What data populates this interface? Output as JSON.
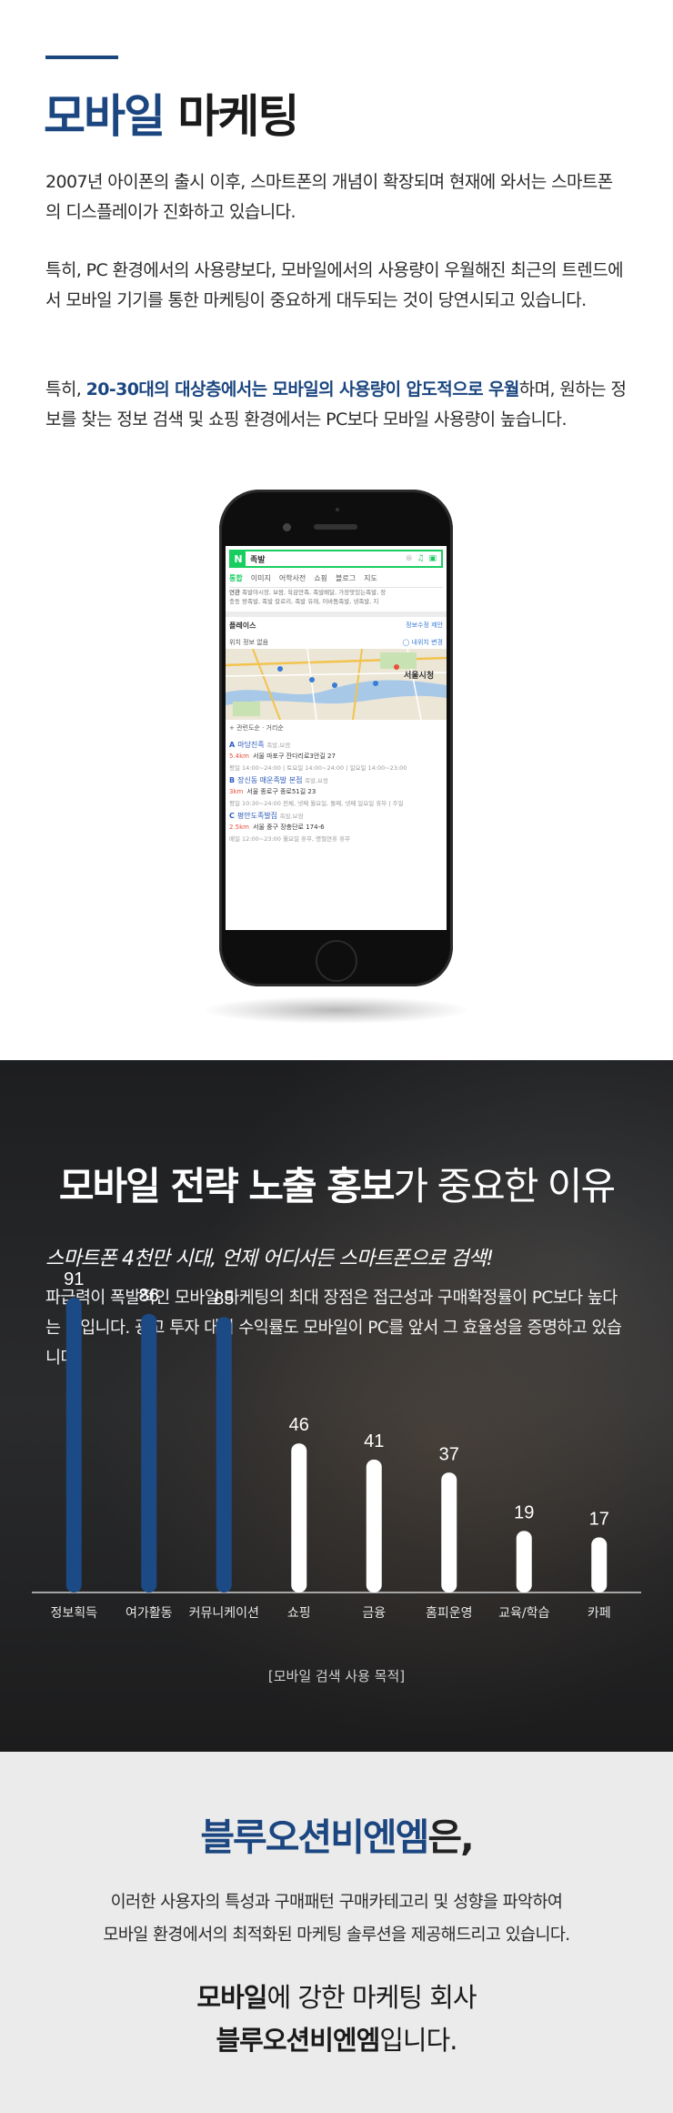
{
  "intro": {
    "title_highlight": "모바일",
    "title_rest": " 마케팅",
    "para1": "2007년 아이폰의 출시 이후, 스마트폰의 개념이 확장되며 현재에 와서는 스마트폰의 디스플레이가 진화하고 있습니다.",
    "para2": "특히, PC 환경에서의 사용량보다, 모바일에서의 사용량이 우월해진 최근의 트렌드에서 모바일 기기를 통한 마케팅이 중요하게 대두되는 것이 당연시되고 있습니다.",
    "para3_prefix": "특히, ",
    "para3_highlight": "20-30대의 대상층에서는 모바일의 사용량이 압도적으로 우월",
    "para3_suffix": "하며, 원하는 정보를 찾는 정보 검색 및 쇼핑 환경에서는 PC보다 모바일 사용량이 높습니다."
  },
  "phone_screen": {
    "logo": "N",
    "query": "족발",
    "tabs": [
      "통합",
      "이미지",
      "어학사전",
      "쇼핑",
      "블로그",
      "지도"
    ],
    "related_label": "연관",
    "related_line1": "족발야시장, 보쌈, 육감만족, 족발배달, 가장맛있는족발, 장",
    "related_line2": "충동 왕족발, 족발 칼로리, 족발 유래, 이바돔족발, 냉족발, 지",
    "places_title": "플레이스",
    "places_edit": "정보수정 제안",
    "location_none": "위치 정보 없음",
    "location_my": "◯ 내위치",
    "location_change": "변경",
    "map_label": "서울시청",
    "more": "+ 관련도순 · 거리순",
    "results": [
      {
        "letter": "A",
        "name": "마당진족",
        "category": "족발,보쌈",
        "dist": "5.4km",
        "address": "서울 마포구 잔다리로3안길 27",
        "hours": "평일 14:00~24:00 | 토요일 14:00~24:00 | 일요일 14:00~23:00"
      },
      {
        "letter": "B",
        "name": "장신동 매운족발 본점",
        "category": "족발,보쌈",
        "dist": "3km",
        "address": "서울 종로구 종로51길 23",
        "hours": "평일 10:30~24:00 전체, 넷째 월요일, 둘째, 넷째 일요일 휴무 | 주일"
      },
      {
        "letter": "C",
        "name": "평안도족발집",
        "category": "족발,보쌈",
        "dist": "2.5km",
        "address": "서울 중구 장충단로 174-6",
        "hours": "매일 12:00~23:00 월요일 휴무, 명절연휴 휴무"
      }
    ]
  },
  "strategy": {
    "heading_bold": "모바일 전략 노출 홍보",
    "heading_rest": "가 중요한 이유",
    "subtitle": "스마트폰 4천만 시대, 언제 어디서든 스마트폰으로 검색!",
    "description": "파급력이 폭발적인 모바일 마케팅의 최대 장점은 접근성과 구매확정률이 PC보다 높다는 것입니다. 광고 투자 대비 수익률도 모바일이 PC를 앞서 그 효율성을 증명하고 있습니다.",
    "caption": "[모바일 검색 사용 목적]"
  },
  "chart_data": {
    "type": "bar",
    "title": "",
    "xlabel": "[모바일 검색 사용 목적]",
    "ylabel": "",
    "categories": [
      "정보획득",
      "여가활동",
      "커뮤니케이션",
      "쇼핑",
      "금융",
      "홈피운영",
      "교육/학습",
      "카페"
    ],
    "values": [
      91,
      86,
      85,
      46,
      41,
      37,
      19,
      17
    ],
    "ylim": [
      0,
      100
    ],
    "grid": false,
    "highlight_count": 3,
    "colors": {
      "highlight": "#1c4a85",
      "normal": "#ffffff",
      "label": "#ffffff"
    }
  },
  "closing": {
    "brand": "블루오션비엔엠",
    "brand_suffix": "은,",
    "text_line1": "이러한 사용자의 특성과 구매패턴 구매카테고리 및 성향을 파악하여",
    "text_line2": "모바일 환경에서의 최적화된 마케팅 솔루션을 제공해드리고 있습니다.",
    "line1_bold": "모바일",
    "line1_rest": "에 강한 마케팅 회사",
    "line2_bold": "블루오션비엔엠",
    "line2_rest": "입니다."
  }
}
